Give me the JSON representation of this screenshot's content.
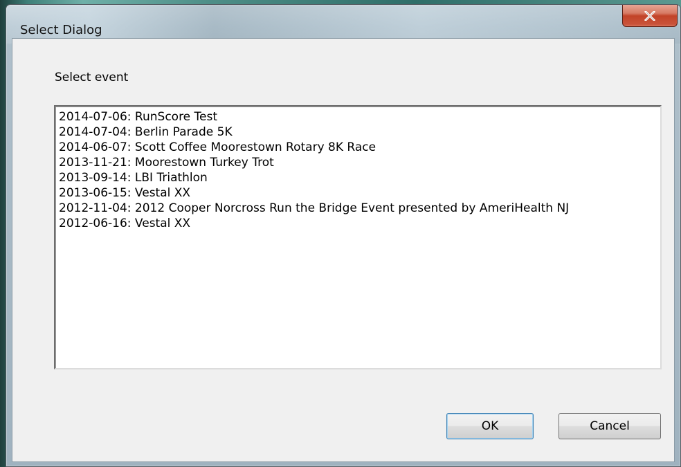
{
  "window": {
    "title": "Select Dialog",
    "close_icon": "close-x-icon"
  },
  "prompt": "Select event",
  "events": [
    "2014-07-06: RunScore Test",
    "2014-07-04: Berlin Parade 5K",
    "2014-06-07: Scott Coffee Moorestown Rotary 8K Race",
    "2013-11-21: Moorestown Turkey Trot",
    "2013-09-14: LBI Triathlon",
    "2013-06-15: Vestal XX",
    "2012-11-04: 2012 Cooper Norcross Run the Bridge Event presented by AmeriHealth NJ",
    "2012-06-16: Vestal XX"
  ],
  "buttons": {
    "ok": "OK",
    "cancel": "Cancel"
  },
  "colors": {
    "close_button": "#c9533a",
    "dialog_background": "#f0f0f0"
  }
}
